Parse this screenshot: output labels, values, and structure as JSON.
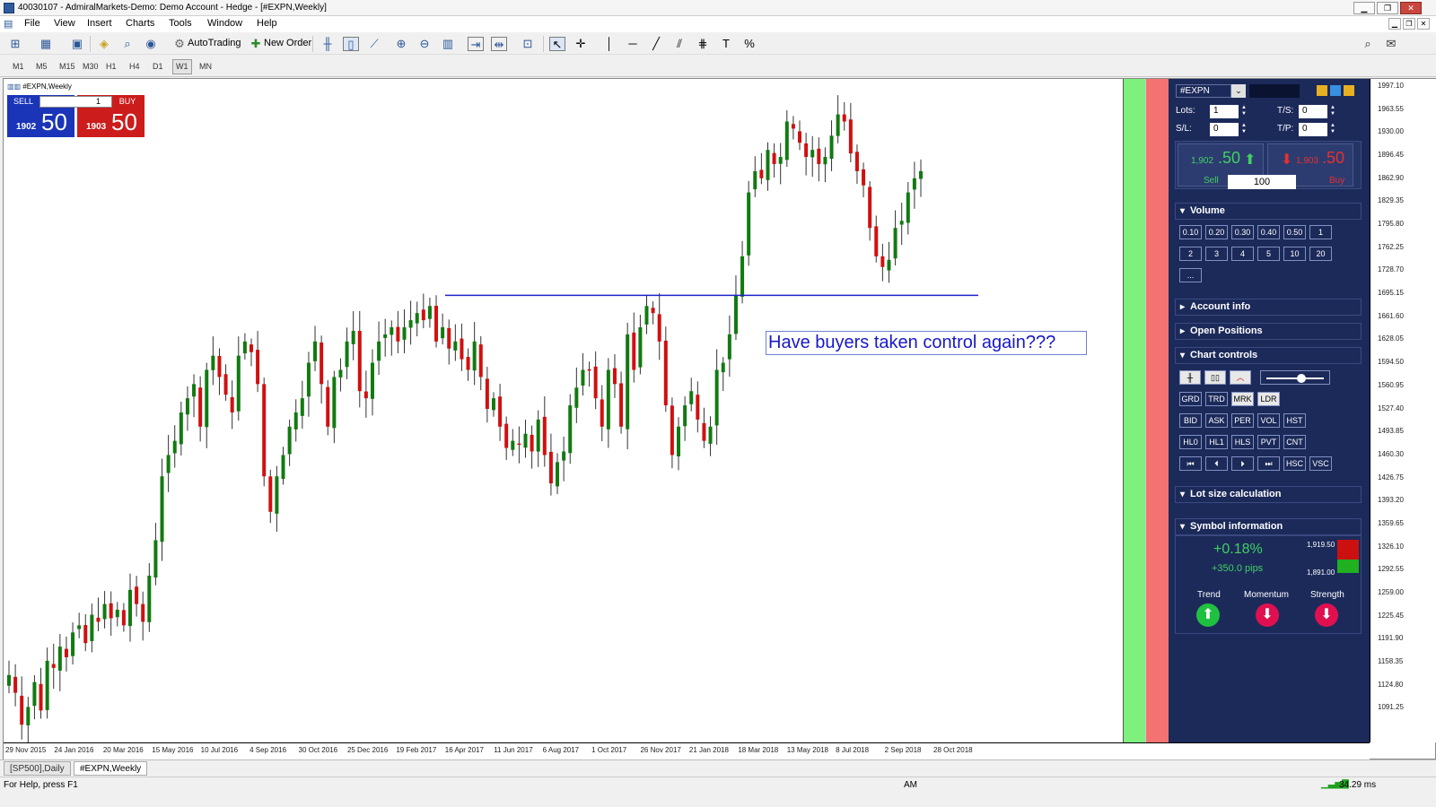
{
  "window": {
    "title": "40030107 - AdmiralMarkets-Demo: Demo Account - Hedge - [#EXPN,Weekly]"
  },
  "menu": [
    "File",
    "View",
    "Insert",
    "Charts",
    "Tools",
    "Window",
    "Help"
  ],
  "toolbar": {
    "autotrading_label": "AutoTrading",
    "new_order_label": "New Order"
  },
  "timeframes": [
    "M1",
    "M5",
    "M15",
    "M30",
    "H1",
    "H4",
    "D1",
    "W1",
    "MN"
  ],
  "active_timeframe": "W1",
  "chart": {
    "label": "#EXPN,Weekly",
    "annotation": "Have buyers taken control again???",
    "trendline_price": 1705
  },
  "one_click": {
    "sell_label": "SELL",
    "buy_label": "BUY",
    "lots": "1",
    "sell_small": "1902",
    "sell_big": "50",
    "buy_small": "1903",
    "buy_big": "50"
  },
  "trade_panel": {
    "symbol": "#EXPN",
    "lots_label": "Lots:",
    "lots": "1",
    "sl_label": "S/L:",
    "sl": "0",
    "ts_label": "T/S:",
    "ts": "0",
    "tp_label": "T/P:",
    "tp": "0",
    "sell_price_small": "1,902",
    "sell_price_big": ".50",
    "sell_label": "Sell",
    "buy_price_small": "1,903",
    "buy_price_big": ".50",
    "buy_label": "Buy",
    "volume_value": "100",
    "sections": {
      "volume": "Volume",
      "account_info": "Account info",
      "open_positions": "Open Positions",
      "chart_controls": "Chart controls",
      "lot_size": "Lot size calculation",
      "symbol_info": "Symbol information"
    },
    "volume_buttons": [
      "0.10",
      "0.20",
      "0.30",
      "0.40",
      "0.50",
      "1",
      "2",
      "3",
      "4",
      "5",
      "10",
      "20",
      "..."
    ],
    "chart_control_rows": [
      [
        "GRD",
        "TRD",
        "MRK",
        "LDR"
      ],
      [
        "BID",
        "ASK",
        "PER",
        "VOL",
        "HST"
      ],
      [
        "HL0",
        "HL1",
        "HLS",
        "PVT",
        "CNT"
      ],
      [
        "⏮",
        "⏴",
        "⏵",
        "⏭",
        "HSC",
        "VSC"
      ]
    ],
    "symbol_info": {
      "change_pct": "+0.18%",
      "change_pips": "+350.0 pips",
      "high": "1,919.50",
      "low": "1,891.00",
      "trend_label": "Trend",
      "momentum_label": "Momentum",
      "strength_label": "Strength"
    }
  },
  "price_scale": [
    "1997.10",
    "1963.55",
    "1930.00",
    "1896.45",
    "1862.90",
    "1829.35",
    "1795.80",
    "1762.25",
    "1728.70",
    "1695.15",
    "1661.60",
    "1628.05",
    "1594.50",
    "1560.95",
    "1527.40",
    "1493.85",
    "1460.30",
    "1426.75",
    "1393.20",
    "1359.65",
    "1326.10",
    "1292.55",
    "1259.00",
    "1225.45",
    "1191.90",
    "1158.35",
    "1124.80",
    "1091.25"
  ],
  "time_scale": [
    "29 Nov 2015",
    "24 Jan 2016",
    "20 Mar 2016",
    "15 May 2016",
    "10 Jul 2016",
    "4 Sep 2016",
    "30 Oct 2016",
    "25 Dec 2016",
    "19 Feb 2017",
    "16 Apr 2017",
    "11 Jun 2017",
    "6 Aug 2017",
    "1 Oct 2017",
    "26 Nov 2017",
    "21 Jan 2018",
    "18 Mar 2018",
    "13 May 2018",
    "8 Jul 2018",
    "2 Sep 2018",
    "28 Oct 2018"
  ],
  "tabs": [
    "[SP500],Daily",
    "#EXPN,Weekly"
  ],
  "active_tab": "#EXPN,Weekly",
  "status": {
    "help": "For Help, press F1",
    "session": "AM",
    "ping": "34.29 ms"
  },
  "chart_data": {
    "type": "candlestick",
    "title": "#EXPN,Weekly",
    "ylim": [
      1075,
      2010
    ],
    "x_start": "29 Nov 2015",
    "x_interval": "1 week",
    "levels": [
      1170,
      1145,
      1100,
      1125,
      1160,
      1120,
      1190,
      1180,
      1210,
      1195,
      1230,
      1240,
      1215,
      1255,
      1245,
      1270,
      1250,
      1262,
      1240,
      1290,
      1270,
      1245,
      1310,
      1360,
      1450,
      1480,
      1500,
      1540,
      1560,
      1580,
      1520,
      1600,
      1620,
      1590,
      1565,
      1540,
      1620,
      1640,
      1625,
      1580,
      1450,
      1400,
      1450,
      1480,
      1520,
      1540,
      1560,
      1610,
      1640,
      1580,
      1520,
      1590,
      1600,
      1640,
      1655,
      1570,
      1560,
      1610,
      1640,
      1650,
      1660,
      1640,
      1660,
      1670,
      1680,
      1670,
      1690,
      1640,
      1660,
      1630,
      1640,
      1615,
      1600,
      1640,
      1590,
      1545,
      1560,
      1520,
      1490,
      1500,
      1495,
      1510,
      1485,
      1530,
      1480,
      1440,
      1470,
      1485,
      1550,
      1575,
      1600,
      1600,
      1560,
      1520,
      1600,
      1580,
      1520,
      1650,
      1600,
      1660,
      1690,
      1680,
      1640,
      1550,
      1480,
      1520,
      1550,
      1570,
      1530,
      1500,
      1520,
      1600,
      1610,
      1650,
      1705,
      1760,
      1850,
      1880,
      1870,
      1910,
      1890,
      1900,
      1950,
      1940,
      1920,
      1900,
      1910,
      1890,
      1900,
      1930,
      1960,
      1950,
      1905,
      1880,
      1860,
      1800,
      1760,
      1745,
      1755,
      1800,
      1810,
      1850,
      1870,
      1880
    ]
  }
}
